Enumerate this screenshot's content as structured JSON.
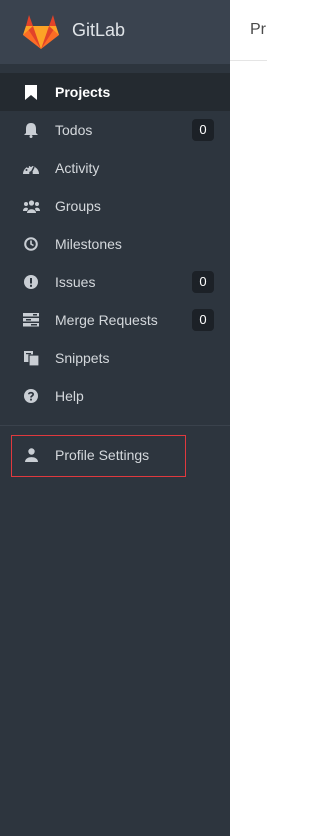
{
  "brand": {
    "name": "GitLab"
  },
  "nav": {
    "items": [
      {
        "label": "Projects",
        "icon": "bookmark-icon",
        "active": true
      },
      {
        "label": "Todos",
        "icon": "bell-icon",
        "badge": "0"
      },
      {
        "label": "Activity",
        "icon": "dashboard-icon"
      },
      {
        "label": "Groups",
        "icon": "users-icon"
      },
      {
        "label": "Milestones",
        "icon": "clock-icon"
      },
      {
        "label": "Issues",
        "icon": "exclamation-circle-icon",
        "badge": "0"
      },
      {
        "label": "Merge Requests",
        "icon": "tasks-icon",
        "badge": "0"
      },
      {
        "label": "Snippets",
        "icon": "clipboard-icon"
      },
      {
        "label": "Help",
        "icon": "question-circle-icon"
      }
    ]
  },
  "profile": {
    "label": "Profile Settings",
    "icon": "user-icon"
  },
  "header": {
    "crumb": "Pr"
  },
  "colors": {
    "sidebar_bg": "#2d353e",
    "brand_bg": "#3a434f",
    "active_bg": "#242a30",
    "highlight_border": "#e0393e",
    "logo_orange": "#fc6d26"
  }
}
